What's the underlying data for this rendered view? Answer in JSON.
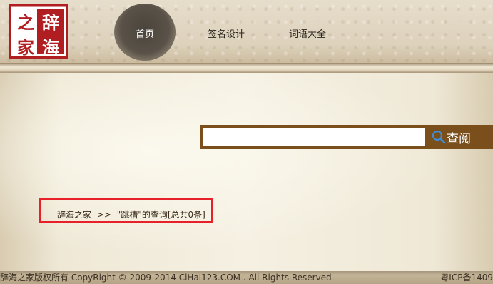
{
  "logo": {
    "chars_left": [
      "之",
      "家"
    ],
    "chars_right": [
      "辞",
      "海"
    ]
  },
  "nav": {
    "home": "首页",
    "sign_design": "签名设计",
    "words": "词语大全"
  },
  "search": {
    "value": "",
    "button_label": "查阅",
    "accent_color": "#7a4f1c"
  },
  "breadcrumb": {
    "home": "辞海之家",
    "separator": ">>",
    "query_text": "\"跳槽\"的查询[总共0条]"
  },
  "footer": {
    "copyright": "辞海之家版权所有 CopyRight © 2009-2014 CiHai123.COM . All Rights Reserved",
    "icp": "粤ICP备1409"
  }
}
